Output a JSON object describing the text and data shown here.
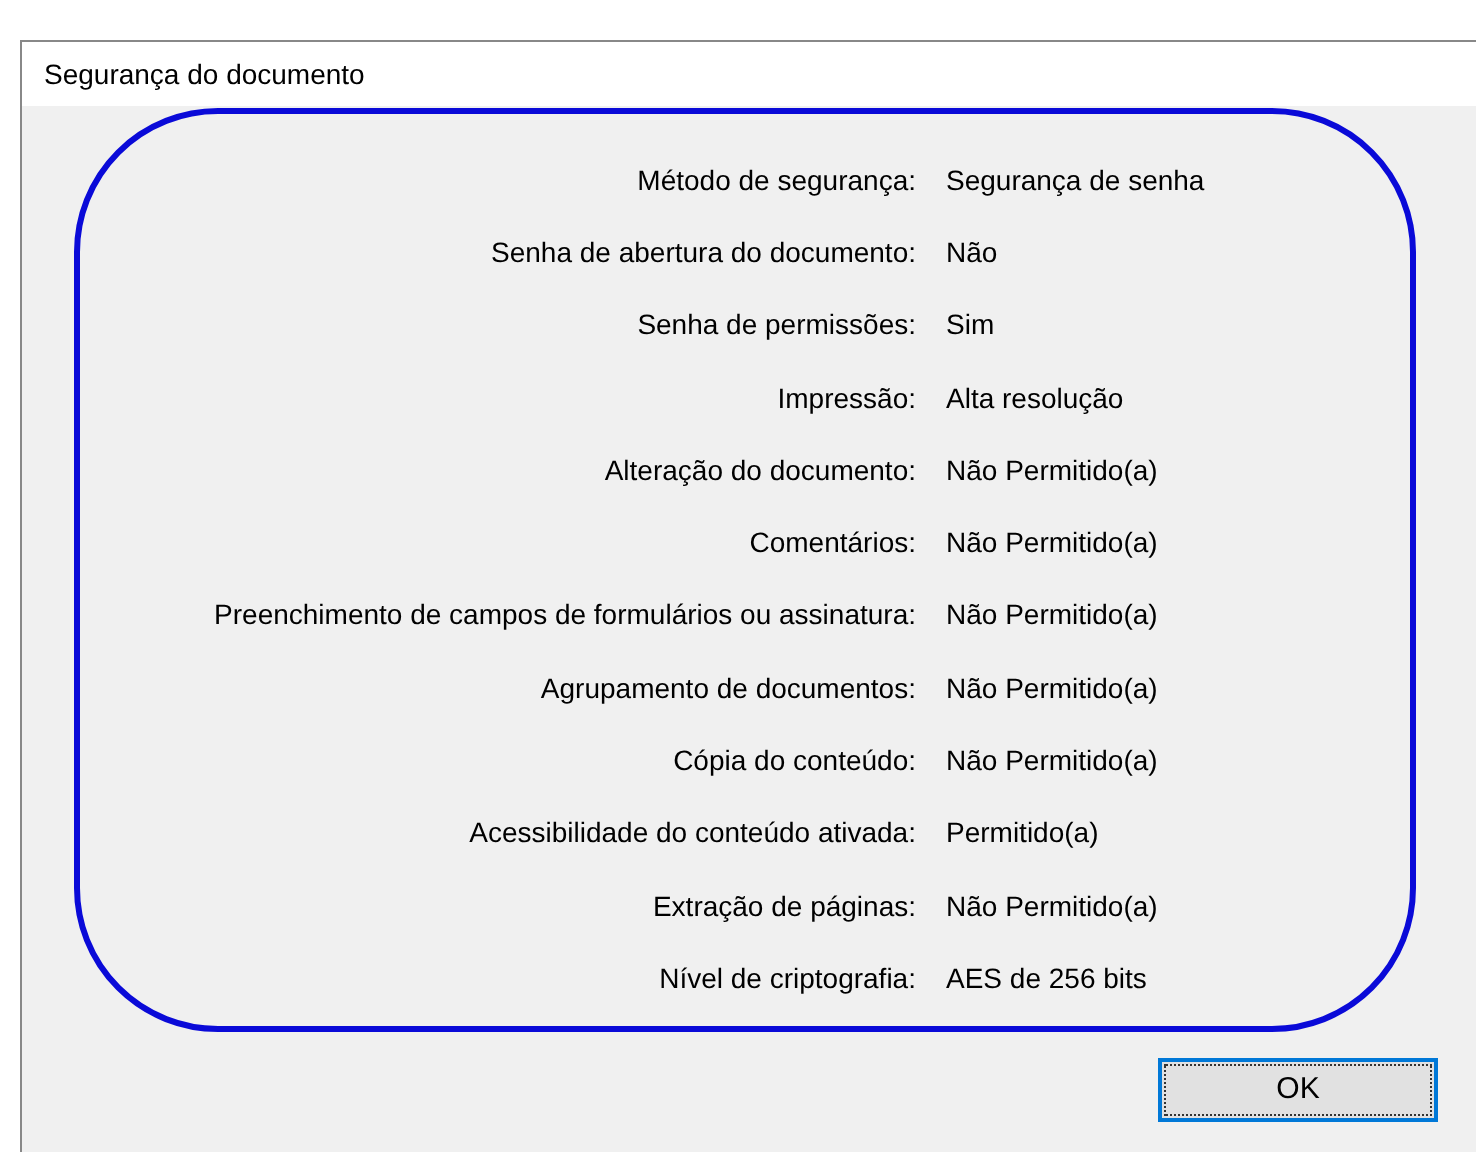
{
  "dialog": {
    "title": "Segurança do documento",
    "fields": [
      {
        "label": "Método de segurança:",
        "value": "Segurança de senha"
      },
      {
        "label": "Senha de abertura do documento:",
        "value": "Não"
      },
      {
        "label": "Senha de permissões:",
        "value": "Sim"
      },
      {
        "label": "Impressão:",
        "value": "Alta resolução"
      },
      {
        "label": "Alteração do documento:",
        "value": "Não Permitido(a)"
      },
      {
        "label": "Comentários:",
        "value": "Não Permitido(a)"
      },
      {
        "label": "Preenchimento de campos de formulários ou assinatura:",
        "value": "Não Permitido(a)"
      },
      {
        "label": "Agrupamento de documentos:",
        "value": "Não Permitido(a)"
      },
      {
        "label": "Cópia do conteúdo:",
        "value": "Não Permitido(a)"
      },
      {
        "label": "Acessibilidade do conteúdo ativada:",
        "value": "Permitido(a)"
      },
      {
        "label": "Extração de páginas:",
        "value": "Não Permitido(a)"
      },
      {
        "label": "Nível de criptografia:",
        "value": "AES de 256 bits"
      }
    ],
    "buttons": [
      "OK"
    ]
  }
}
